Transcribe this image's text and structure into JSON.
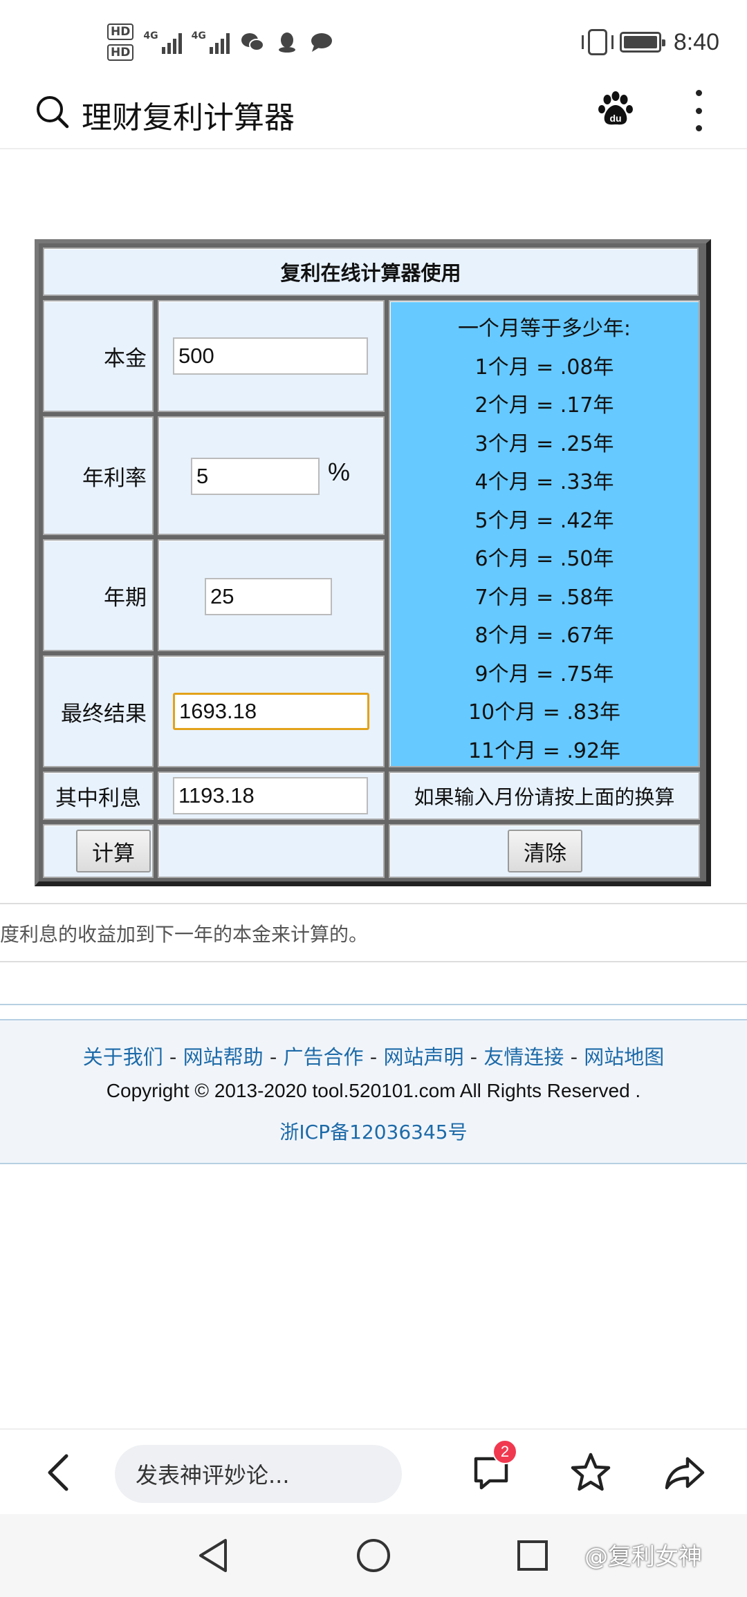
{
  "status": {
    "hd1": "HD",
    "hd2": "HD",
    "net1": "4G",
    "net2": "4G",
    "time": "8:40"
  },
  "header": {
    "title": "理财复利计算器"
  },
  "calculator": {
    "title": "复利在线计算器使用",
    "principal_label": "本金",
    "principal_value": "500",
    "rate_label": "年利率",
    "rate_value": "5",
    "rate_unit": "%",
    "period_label": "年期",
    "period_value": "25",
    "result_label": "最终结果",
    "result_value": "1693.18",
    "interest_label": "其中利息",
    "interest_value": "1193.18",
    "conversion_title": "一个月等于多少年:",
    "conversions": [
      "1个月 = .08年",
      "2个月 = .17年",
      "3个月 = .25年",
      "4个月 = .33年",
      "5个月 = .42年",
      "6个月 = .50年",
      "7个月 = .58年",
      "8个月 = .67年",
      "9个月 = .75年",
      "10个月 = .83年",
      "11个月 = .92年"
    ],
    "hint": "如果输入月份请按上面的换算",
    "calc_button": "计算",
    "clear_button": "清除"
  },
  "description": "度利息的收益加到下一年的本金来计算的。",
  "footer": {
    "links": [
      "关于我们",
      "网站帮助",
      "广告合作",
      "网站声明",
      "友情连接",
      "网站地图"
    ],
    "separator": " - ",
    "copyright": "Copyright © 2013-2020 tool.520101.com All Rights Reserved .",
    "icp": "浙ICP备12036345号"
  },
  "bottom_bar": {
    "comment_placeholder": "发表神评妙论...",
    "comment_count": "2"
  },
  "watermark": "@复利女神"
}
